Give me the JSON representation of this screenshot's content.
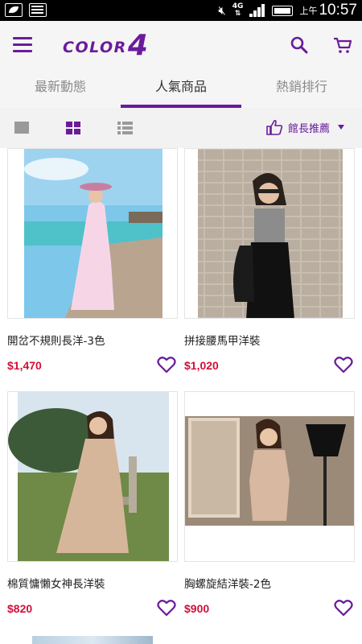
{
  "status_bar": {
    "network_label": "4G",
    "time_prefix": "上午",
    "time": "10:57"
  },
  "app": {
    "logo_text": "COLOR",
    "logo_number": "4",
    "brand_color": "#6a1b9a"
  },
  "tabs": [
    {
      "label": "最新動態",
      "active": false
    },
    {
      "label": "人氣商品",
      "active": true
    },
    {
      "label": "熱銷排行",
      "active": false
    }
  ],
  "view_toolbar": {
    "modes": [
      "single-view-icon",
      "grid-view-icon",
      "list-view-icon"
    ],
    "selected_mode": "grid",
    "sort_label": "館長推薦"
  },
  "products": [
    {
      "title": "開岔不規則長洋-3色",
      "price": "$1,470"
    },
    {
      "title": "拼接腰馬甲洋裝",
      "price": "$1,020"
    },
    {
      "title": "棉質慵懶女神長洋裝",
      "price": "$820"
    },
    {
      "title": "胸螺旋結洋裝-2色",
      "price": "$900"
    }
  ],
  "colors": {
    "accent": "#6a1b9a",
    "price": "#d0103a"
  }
}
